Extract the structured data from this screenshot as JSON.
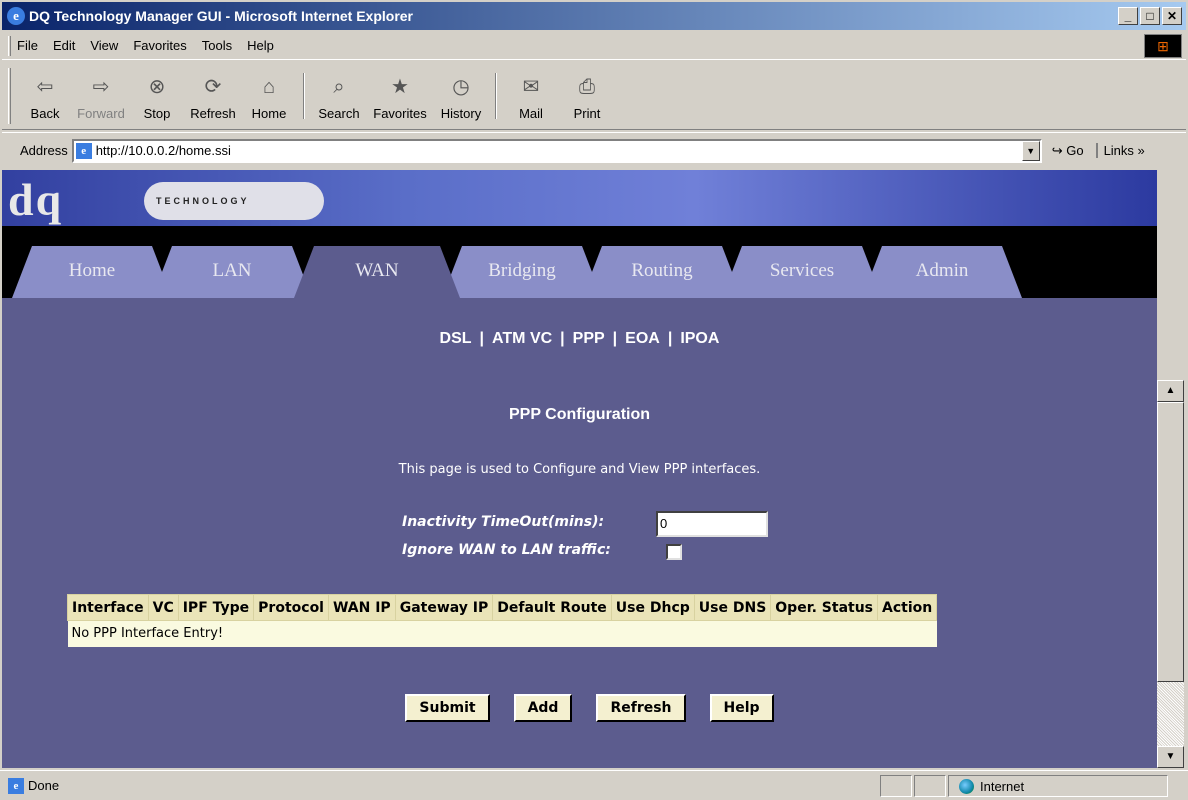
{
  "window": {
    "title": "DQ Technology Manager GUI - Microsoft Internet Explorer",
    "ie_icon": "ie-icon",
    "controls": [
      "_",
      "□",
      "✕"
    ]
  },
  "menu": [
    "File",
    "Edit",
    "View",
    "Favorites",
    "Tools",
    "Help"
  ],
  "toolbar": [
    {
      "label": "Back",
      "icon": "back-arrow-icon",
      "glyph": "⇦",
      "disabled": false
    },
    {
      "label": "Forward",
      "icon": "forward-arrow-icon",
      "glyph": "⇨",
      "disabled": true
    },
    {
      "label": "Stop",
      "icon": "stop-icon",
      "glyph": "⊗",
      "disabled": false
    },
    {
      "label": "Refresh",
      "icon": "refresh-icon",
      "glyph": "⟳",
      "disabled": false
    },
    {
      "label": "Home",
      "icon": "home-icon",
      "glyph": "⌂",
      "disabled": false
    },
    {
      "label": "Search",
      "icon": "search-icon",
      "glyph": "⌕",
      "disabled": false
    },
    {
      "label": "Favorites",
      "icon": "favorites-icon",
      "glyph": "★",
      "disabled": false
    },
    {
      "label": "History",
      "icon": "history-icon",
      "glyph": "◷",
      "disabled": false
    },
    {
      "label": "Mail",
      "icon": "mail-icon",
      "glyph": "✉",
      "disabled": false
    },
    {
      "label": "Print",
      "icon": "print-icon",
      "glyph": "⎙",
      "disabled": false
    }
  ],
  "address": {
    "label": "Address",
    "url": "http://10.0.0.2/home.ssi",
    "go": "Go",
    "links": "Links »"
  },
  "brand": {
    "logo": "dq",
    "tagline": "TECHNOLOGY"
  },
  "tabs": [
    "Home",
    "LAN",
    "WAN",
    "Bridging",
    "Routing",
    "Services",
    "Admin"
  ],
  "active_tab": "WAN",
  "subnav": [
    "DSL",
    "ATM VC",
    "PPP",
    "EOA",
    "IPOA"
  ],
  "page": {
    "title": "PPP Configuration",
    "description": "This page is used to Configure and View PPP interfaces.",
    "inactivity_label": "Inactivity TimeOut(mins):",
    "inactivity_value": "0",
    "ignore_label": "Ignore WAN to LAN traffic:",
    "ignore_checked": false
  },
  "table": {
    "headers": [
      "Interface",
      "VC",
      "IPF Type",
      "Protocol",
      "WAN IP",
      "Gateway IP",
      "Default Route",
      "Use Dhcp",
      "Use DNS",
      "Oper. Status",
      "Action"
    ],
    "empty_text": "No PPP Interface Entry!"
  },
  "buttons": [
    "Submit",
    "Add",
    "Refresh",
    "Help"
  ],
  "status": {
    "text": "Done",
    "zone": "Internet"
  },
  "colors": {
    "content_bg": "#5c5c8e",
    "tab_bg": "#8a8ec8",
    "table_header": "#eae4b8",
    "table_row": "#fafae0"
  }
}
